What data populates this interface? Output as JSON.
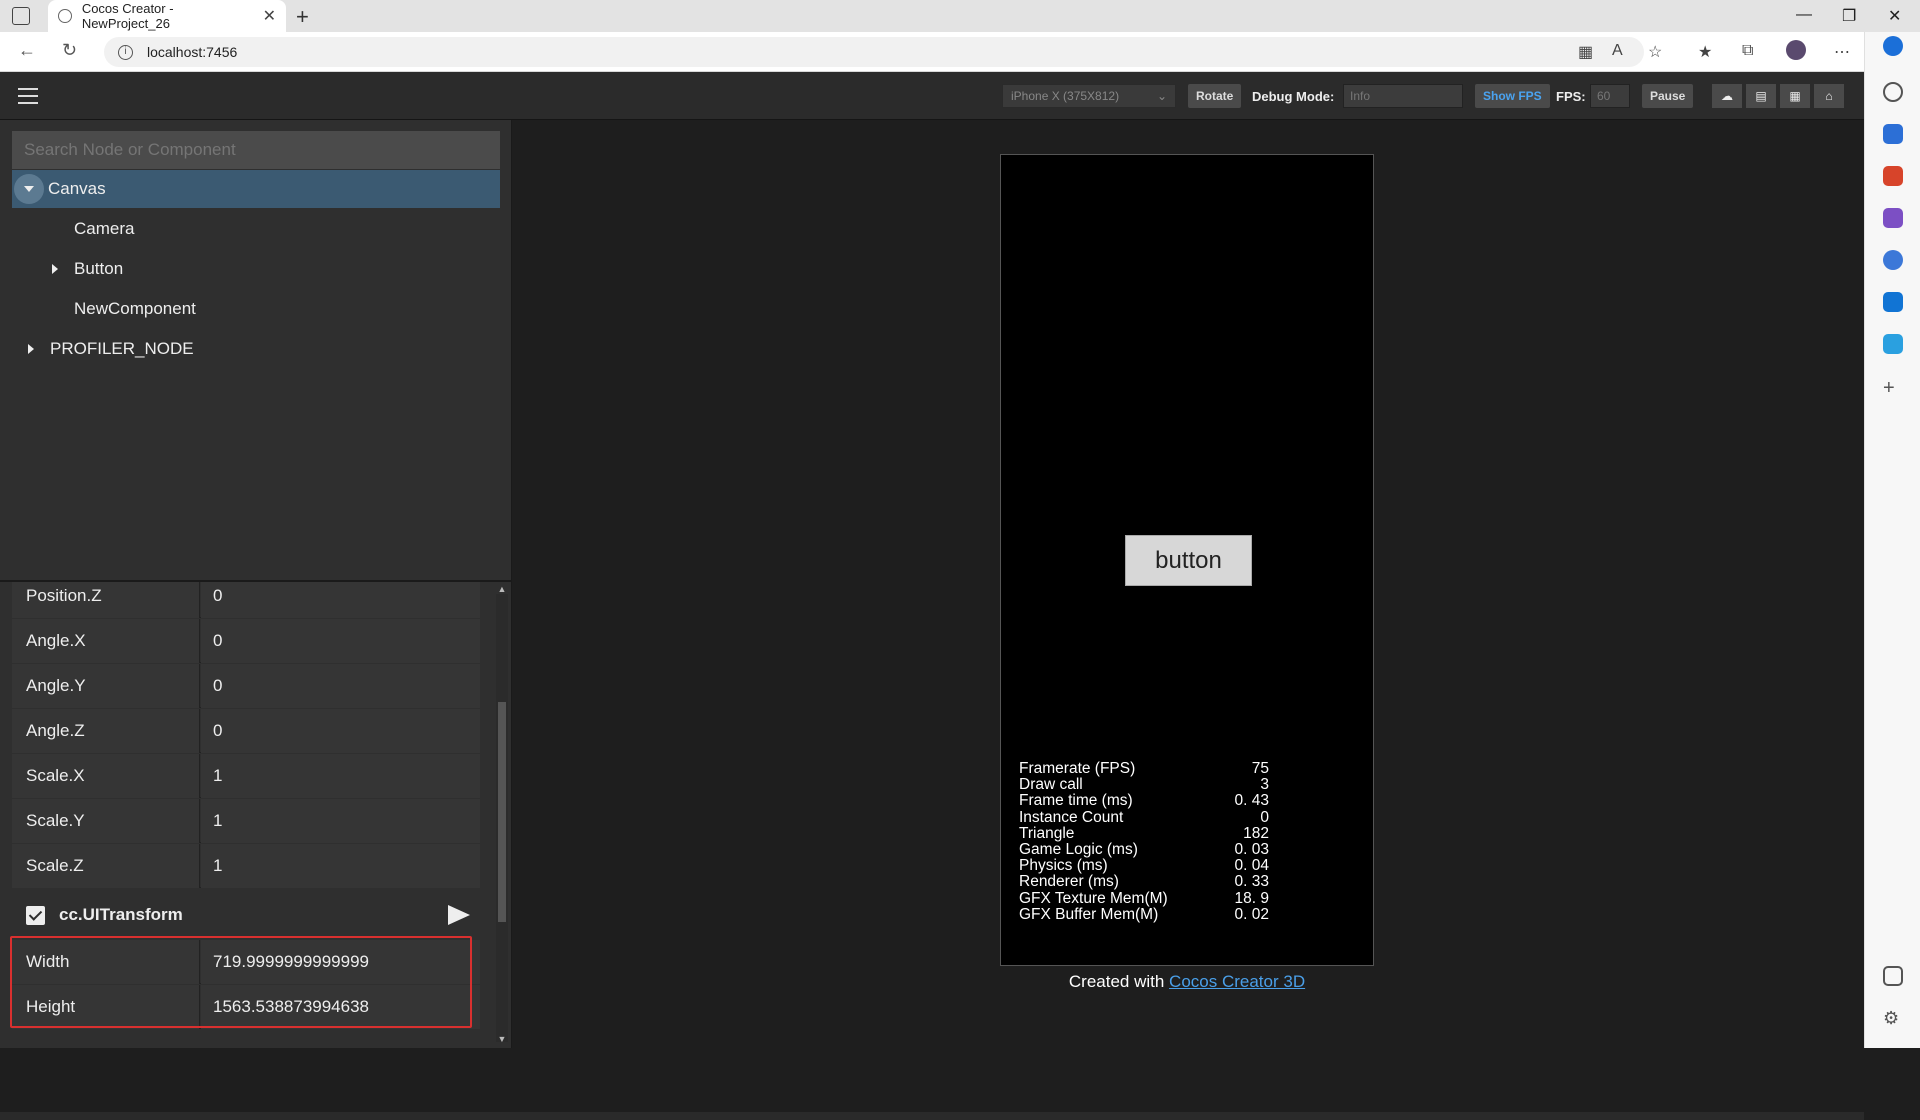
{
  "browser": {
    "tab_title": "Cocos Creator - NewProject_26",
    "url": "localhost:7456"
  },
  "toolbar": {
    "device": "iPhone X (375X812)",
    "rotate": "Rotate",
    "debug_label": "Debug Mode:",
    "debug_value": "Info",
    "show_fps": "Show FPS",
    "fps_label": "FPS:",
    "fps_value": "60",
    "pause": "Pause"
  },
  "hierarchy": {
    "search_placeholder": "Search Node or Component",
    "nodes": [
      "Canvas",
      "Camera",
      "Button",
      "NewComponent",
      "PROFILER_NODE"
    ]
  },
  "properties": {
    "rows": [
      {
        "label": "Position.Z",
        "value": "0"
      },
      {
        "label": "Angle.X",
        "value": "0"
      },
      {
        "label": "Angle.Y",
        "value": "0"
      },
      {
        "label": "Angle.Z",
        "value": "0"
      },
      {
        "label": "Scale.X",
        "value": "1"
      },
      {
        "label": "Scale.Y",
        "value": "1"
      },
      {
        "label": "Scale.Z",
        "value": "1"
      }
    ],
    "component": "cc.UITransform",
    "ui_rows": [
      {
        "label": "Width",
        "value": "719.9999999999999"
      },
      {
        "label": "Height",
        "value": "1563.538873994638"
      }
    ]
  },
  "game": {
    "button_label": "button",
    "stats": [
      {
        "name": "Framerate (FPS)",
        "value": "75"
      },
      {
        "name": "Draw call",
        "value": "3"
      },
      {
        "name": "Frame time (ms)",
        "value": "0. 43"
      },
      {
        "name": "Instance Count",
        "value": "0"
      },
      {
        "name": "Triangle",
        "value": "182"
      },
      {
        "name": "Game Logic (ms)",
        "value": "0. 03"
      },
      {
        "name": "Physics (ms)",
        "value": "0. 04"
      },
      {
        "name": "Renderer (ms)",
        "value": "0. 33"
      },
      {
        "name": "GFX Texture Mem(M)",
        "value": "18. 9"
      },
      {
        "name": "GFX Buffer Mem(M)",
        "value": "0. 02"
      }
    ],
    "created_prefix": "Created with ",
    "created_link": "Cocos Creator 3D"
  },
  "colors": {
    "accent_show_fps": "#4aa3f0",
    "selection": "#3b5a72",
    "highlight_box": "#d9302f"
  }
}
